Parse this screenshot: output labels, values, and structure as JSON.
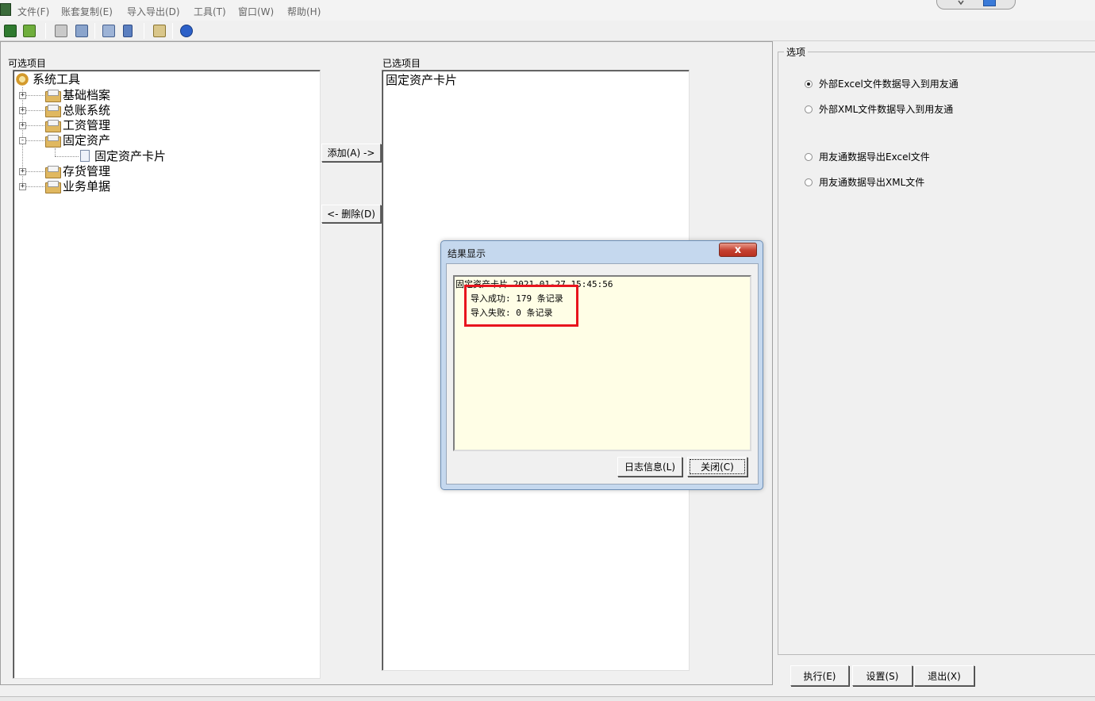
{
  "menubar": {
    "items": [
      "文件(F)",
      "账套复制(E)",
      "导入导出(D)",
      "工具(T)",
      "窗口(W)",
      "帮助(H)"
    ]
  },
  "toolbar": {
    "buttons": [
      "excel-icon",
      "export-icon",
      "tools-icon",
      "copy-window-icon",
      "print-icon",
      "database-icon",
      "edit-icon",
      "help-icon"
    ]
  },
  "left_panel": {
    "label": "可选项目",
    "tree": {
      "root": "系统工具",
      "items": [
        "基础档案",
        "总账系统",
        "工资管理",
        "固定资产",
        "存货管理",
        "业务单据"
      ],
      "child": "固定资产卡片"
    }
  },
  "middle_buttons": {
    "add": "添加(A) ->",
    "remove": "<- 删除(D)"
  },
  "right_panel": {
    "label": "已选项目",
    "items": [
      "固定资产卡片"
    ]
  },
  "options": {
    "legend": "选项",
    "radios": [
      {
        "label": "外部Excel文件数据导入到用友通",
        "checked": true
      },
      {
        "label": "外部XML文件数据导入到用友通",
        "checked": false
      },
      {
        "label": "用友通数据导出Excel文件",
        "checked": false
      },
      {
        "label": "用友通数据导出XML文件",
        "checked": false
      }
    ]
  },
  "bottom_buttons": {
    "execute": "执行(E)",
    "settings": "设置(S)",
    "exit": "退出(X)"
  },
  "dialog": {
    "title": "结果显示",
    "close_glyph": "x",
    "log_header": "固定资产卡片    2021-01-27 15:45:56",
    "success": "导入成功: 179 条记录",
    "failure": "导入失败: 0 条记录",
    "log_button": "日志信息(L)",
    "close_button": "关闭(C)"
  },
  "colors": {
    "highlight": "#e8141e",
    "dialog_text_bg": "#fffee6",
    "dialog_frame": "#c5d8ee"
  }
}
